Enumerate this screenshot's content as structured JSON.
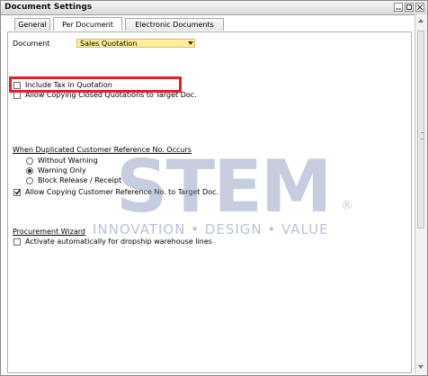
{
  "window": {
    "title": "Document Settings"
  },
  "tabs": [
    {
      "label": "General"
    },
    {
      "label": "Per Document"
    },
    {
      "label": "Electronic Documents"
    }
  ],
  "document": {
    "label": "Document",
    "selected": "Sales Quotation"
  },
  "options": {
    "include_tax": "Include Tax in Quotation",
    "allow_copying_closed": "Allow Copying Closed Quotations to Target Doc."
  },
  "duplicate_ref": {
    "heading": "When Duplicated Customer Reference No. Occurs",
    "choices": [
      "Without Warning",
      "Warning Only",
      "Block Release / Receipt"
    ],
    "selected_index": 1
  },
  "allow_copying_ref": "Allow Copying Customer Reference No. to Target Doc.",
  "procurement": {
    "heading": "Procurement Wizard",
    "activate_label": "Activate automatically for dropship warehouse lines"
  },
  "watermark": {
    "brand": "STEM",
    "registered": "®",
    "tagline": "INNOVATION • DESIGN • VALUE"
  },
  "colors": {
    "highlight": "#e0212b",
    "select_bg": "#ffee99",
    "watermark": "#7f91b8"
  }
}
